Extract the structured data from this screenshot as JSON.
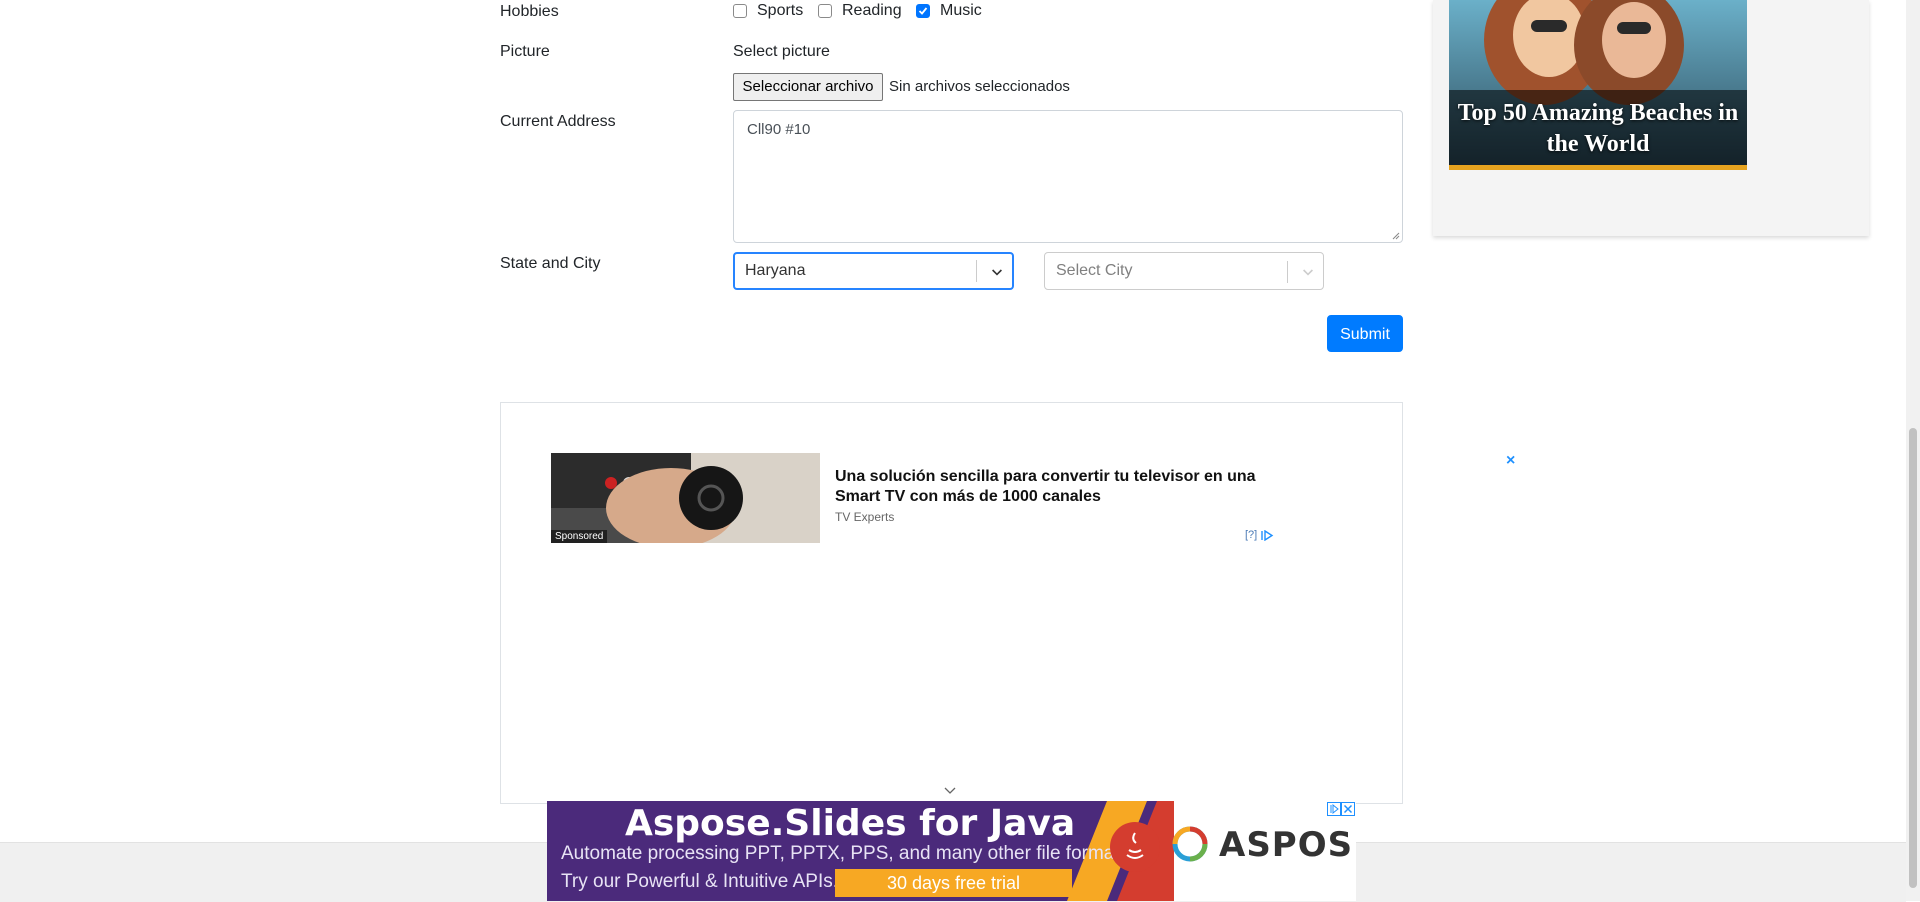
{
  "form": {
    "hobbies_label": "Hobbies",
    "hobbies": [
      {
        "label": "Sports",
        "checked": false
      },
      {
        "label": "Reading",
        "checked": false
      },
      {
        "label": "Music",
        "checked": true
      }
    ],
    "picture_label": "Picture",
    "picture_hint": "Select picture",
    "file_button": "Seleccionar archivo",
    "file_status": "Sin archivos seleccionados",
    "address_label": "Current Address",
    "address_value": "Cll90 #10",
    "state_city_label": "State and City",
    "state_value": "Haryana",
    "city_placeholder": "Select City",
    "submit": "Submit"
  },
  "sponsored_ad": {
    "tag": "Sponsored",
    "headline": "Una solución sencilla para convertir tu televisor en una Smart TV con más de 1000 canales",
    "source": "TV Experts",
    "info": "[?]",
    "close": "×"
  },
  "side_banner": {
    "caption": "Top 50 Amazing Beaches in the World"
  },
  "bottom_banner": {
    "title": "Aspose.Slides for Java",
    "line1": "Automate processing PPT, PPTX, PPS, and many other file formats.",
    "line2": "Try our Powerful & Intuitive APIs.",
    "cta": "30 days free trial",
    "logo": "ASPOSE"
  },
  "colors": {
    "primary": "#007bff",
    "checkbox_checked": "#0075ff",
    "aspose_purple": "#4b2a7b",
    "aspose_orange": "#f7a823"
  }
}
